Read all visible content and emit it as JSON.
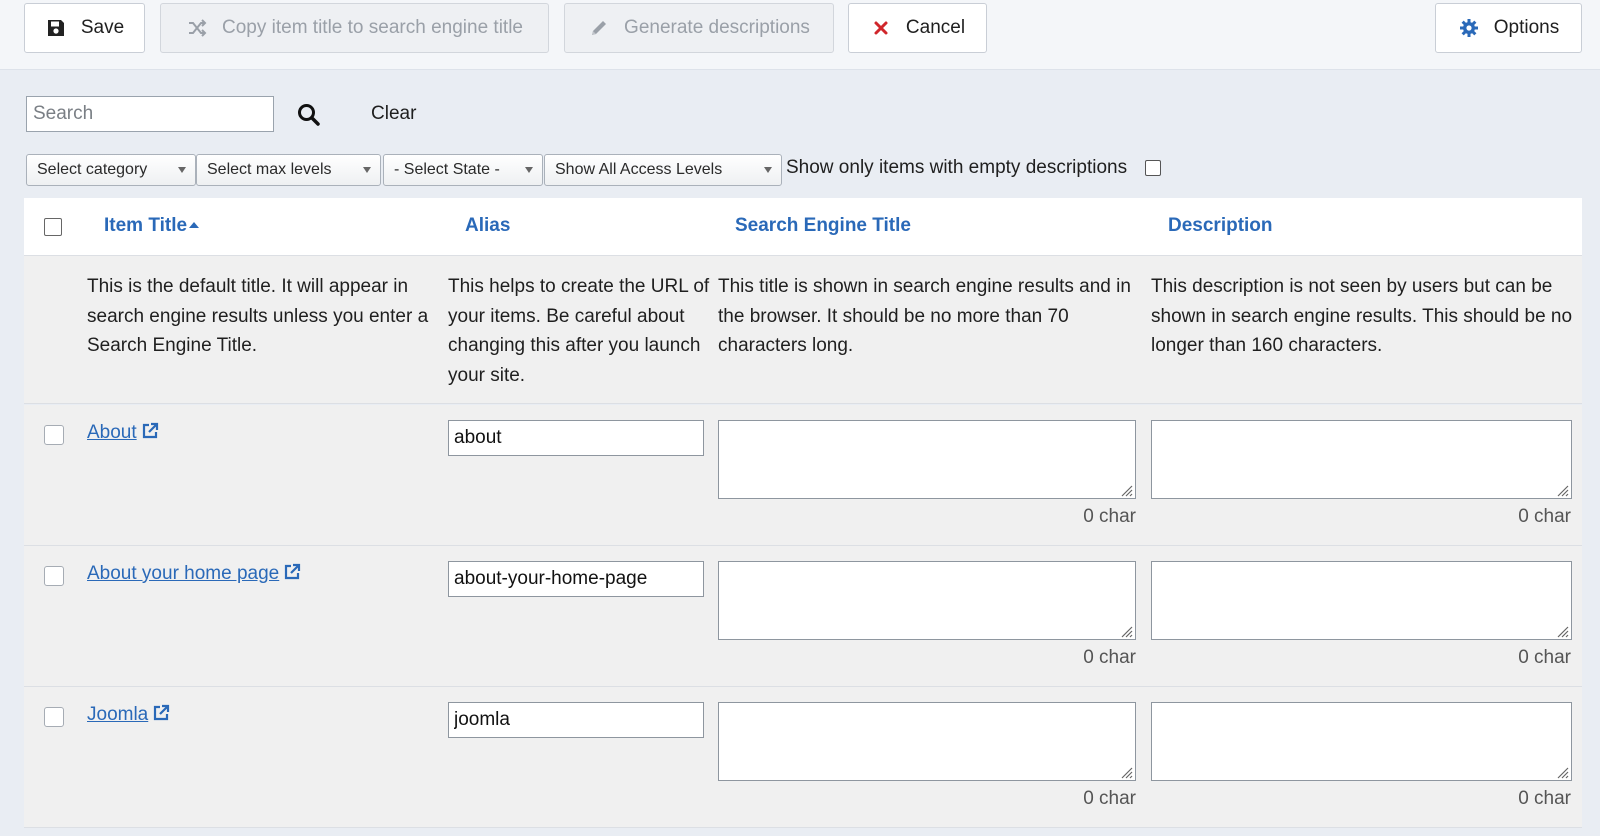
{
  "toolbar": {
    "save_label": "Save",
    "copy_label": "Copy item title to search engine title",
    "generate_label": "Generate descriptions",
    "cancel_label": "Cancel",
    "options_label": "Options"
  },
  "search": {
    "placeholder": "Search",
    "value": "",
    "clear_label": "Clear"
  },
  "filters": {
    "category": "Select category",
    "max_levels": "Select max levels",
    "state": "- Select State -",
    "access": "Show All Access Levels",
    "empty_desc_label": "Show only items with empty descriptions",
    "empty_desc_checked": false
  },
  "table": {
    "columns": {
      "title": "Item Title",
      "alias": "Alias",
      "se_title": "Search Engine Title",
      "description": "Description"
    },
    "help": {
      "title": "This is the default title. It will appear in search engine results unless you enter a Search Engine Title.",
      "alias": "This helps to create the URL of your items. Be careful about changing this after you launch your site.",
      "se_title": "This title is shown in search engine results and in the browser. It should be no more than 70 characters long.",
      "description": "This description is not seen by users but can be shown in search engine results. This should be no longer than 160 characters."
    },
    "rows": [
      {
        "title": "About",
        "alias": "about",
        "se_title": "",
        "description": "",
        "se_count": "0 char",
        "desc_count": "0 char"
      },
      {
        "title": "About your home page",
        "alias": "about-your-home-page",
        "se_title": "",
        "description": "",
        "se_count": "0 char",
        "desc_count": "0 char"
      },
      {
        "title": "Joomla",
        "alias": "joomla",
        "se_title": "",
        "description": "",
        "se_count": "0 char",
        "desc_count": "0 char"
      }
    ]
  },
  "colors": {
    "link": "#2a69b8",
    "cancel_icon": "#d0262b",
    "options_icon": "#2a69b8"
  }
}
